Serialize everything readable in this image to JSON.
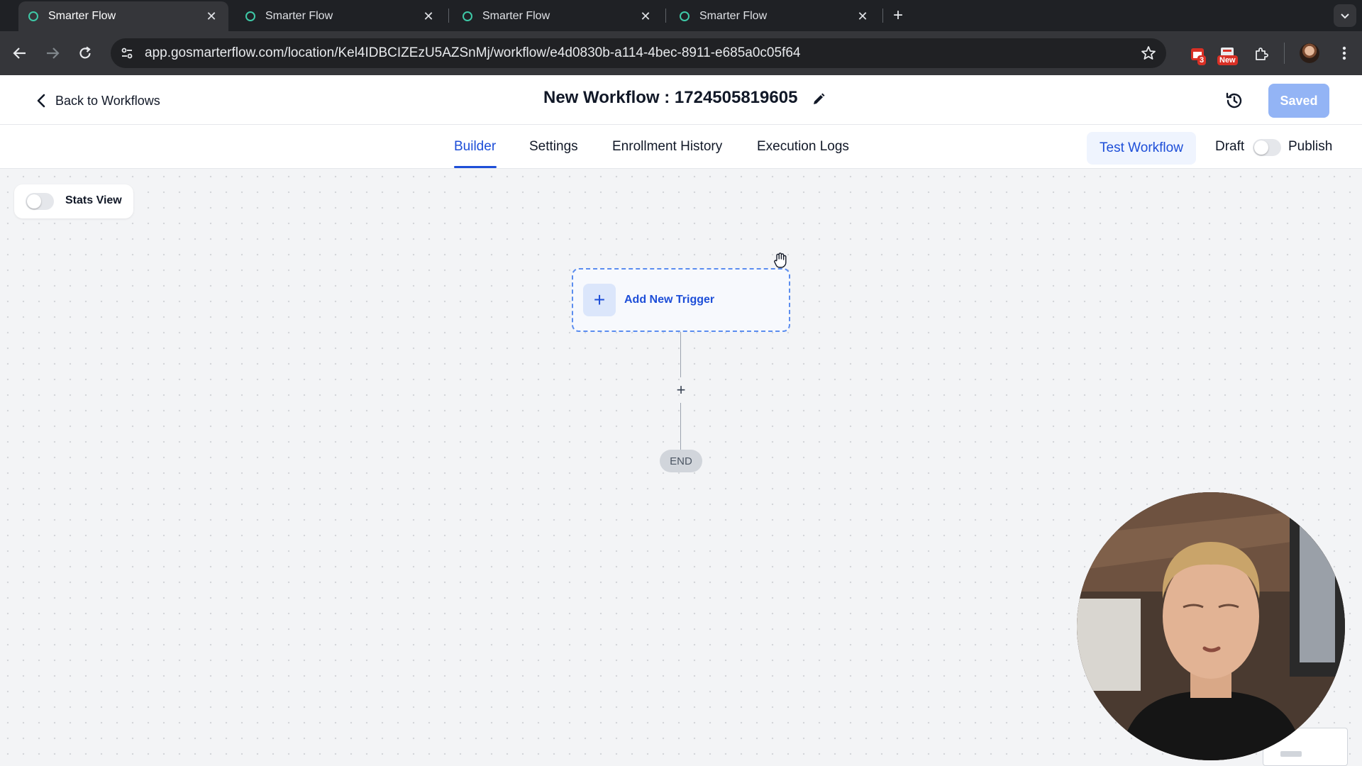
{
  "browser": {
    "tabs": [
      {
        "title": "Smarter Flow",
        "active": true
      },
      {
        "title": "Smarter Flow",
        "active": false
      },
      {
        "title": "Smarter Flow",
        "active": false
      },
      {
        "title": "Smarter Flow",
        "active": false
      }
    ],
    "close_glyph": "✕",
    "new_tab_glyph": "+",
    "url": "app.gosmarterflow.com/location/Kel4IDBCIZEzU5AZSnMj/workflow/e4d0830b-a114-4bec-8911-e685a0c05f64",
    "extensions": [
      {
        "name": "calendar-extension-icon",
        "badge": "3",
        "color": "#d93025"
      },
      {
        "name": "new-extension-icon",
        "badge": "New",
        "color": "#d93025"
      },
      {
        "name": "puzzle-icon"
      }
    ]
  },
  "header": {
    "back_label": "Back to Workflows",
    "title": "New Workflow : 1724505819605",
    "saved_label": "Saved"
  },
  "nav": {
    "tabs": [
      {
        "label": "Builder",
        "active": true
      },
      {
        "label": "Settings",
        "active": false
      },
      {
        "label": "Enrollment History",
        "active": false
      },
      {
        "label": "Execution Logs",
        "active": false
      }
    ],
    "test_label": "Test Workflow",
    "draft_label": "Draft",
    "publish_label": "Publish",
    "publish_on": false
  },
  "canvas": {
    "stats_label": "Stats View",
    "stats_on": false,
    "trigger_label": "Add New Trigger",
    "add_glyph": "+",
    "end_label": "END"
  },
  "colors": {
    "accent": "#1d4ed8",
    "saved_button": "#93b4f5",
    "trigger_border": "#5b8def",
    "tab_favicon": "#3ec9a7"
  }
}
